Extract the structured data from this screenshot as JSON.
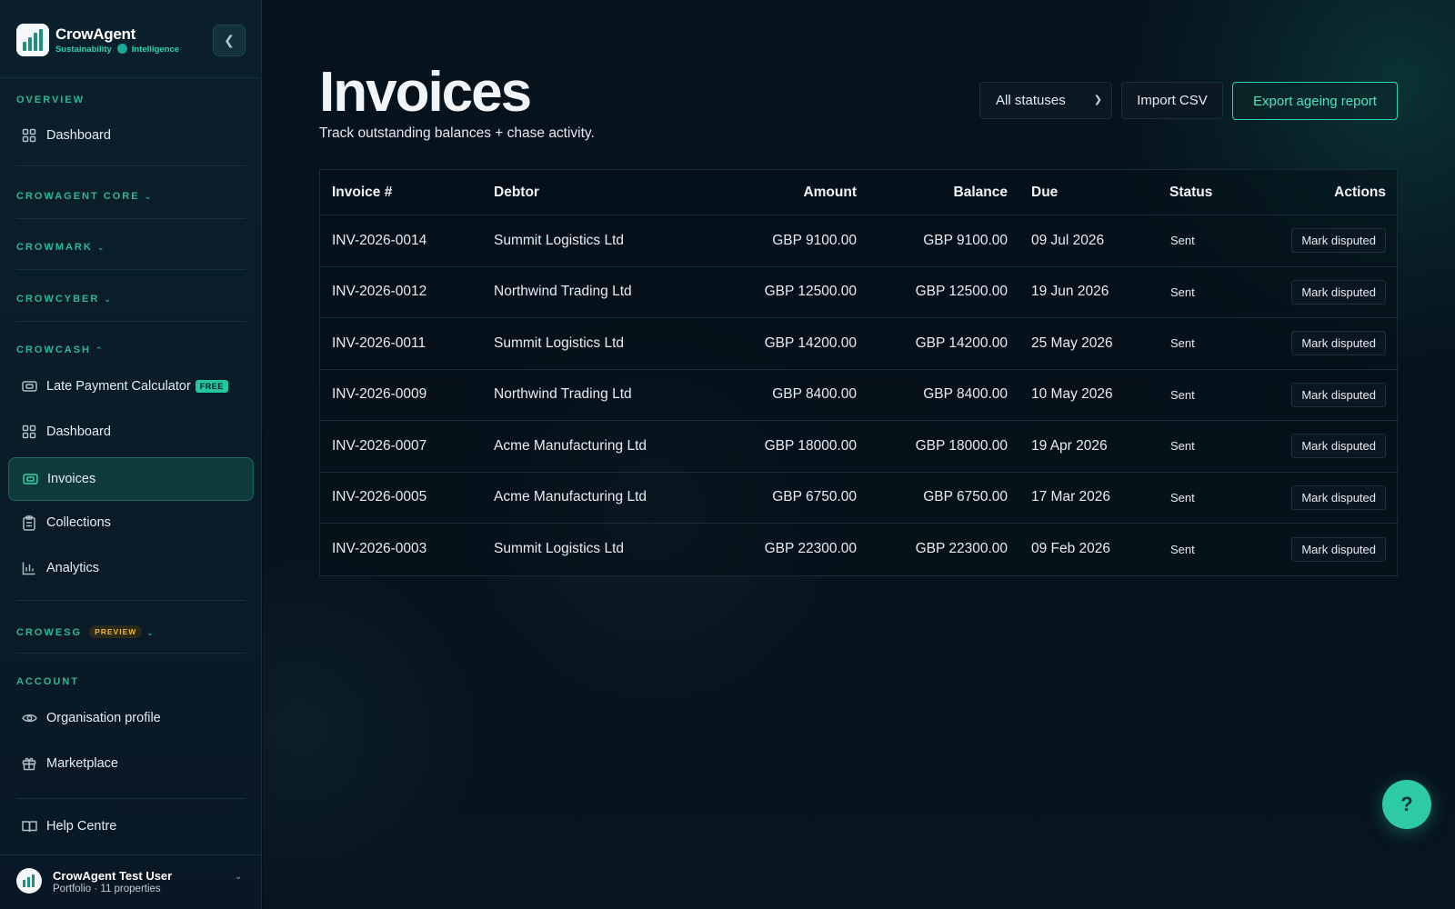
{
  "brand": {
    "name": "CrowAgent",
    "tag_left": "Sustainability",
    "tag_right": "Intelligence"
  },
  "sidebar": {
    "overview_label": "OVERVIEW",
    "overview_items": [
      {
        "label": "Dashboard",
        "icon": "grid-icon"
      }
    ],
    "core_label": "CROWAGENT CORE",
    "crowmark_label": "CROWMARK",
    "crowcyber_label": "CROWCYBER",
    "crowcash_label": "CROWCASH",
    "crowcash_items": [
      {
        "label": "Late Payment Calculator",
        "badge": "FREE",
        "icon": "calculator-icon"
      },
      {
        "label": "Dashboard",
        "icon": "grid-icon"
      },
      {
        "label": "Invoices",
        "icon": "invoice-icon",
        "active": true
      },
      {
        "label": "Collections",
        "icon": "clipboard-icon"
      },
      {
        "label": "Analytics",
        "icon": "bar-chart-icon"
      }
    ],
    "crowesg_label": "CROWESG",
    "crowesg_badge": "PREVIEW",
    "account_label": "ACCOUNT",
    "account_items": [
      {
        "label": "Organisation profile",
        "icon": "eye-icon"
      },
      {
        "label": "Marketplace",
        "icon": "gift-icon"
      }
    ],
    "help_label": "Help Centre",
    "user": {
      "name": "CrowAgent Test User",
      "subtitle": "Portfolio · 11 properties"
    }
  },
  "header": {
    "title": "Invoices",
    "subtitle": "Track outstanding balances + chase activity.",
    "status_filter": "All statuses",
    "import_label": "Import CSV",
    "export_label": "Export ageing report"
  },
  "table": {
    "columns": [
      "Invoice #",
      "Debtor",
      "Amount",
      "Balance",
      "Due",
      "Status",
      "Actions"
    ],
    "rows": [
      {
        "invoice": "INV-2026-0014",
        "debtor": "Summit Logistics Ltd",
        "amount": "GBP 9100.00",
        "balance": "GBP 9100.00",
        "due": "09 Jul 2026",
        "status": "Sent",
        "action": "Mark disputed"
      },
      {
        "invoice": "INV-2026-0012",
        "debtor": "Northwind Trading Ltd",
        "amount": "GBP 12500.00",
        "balance": "GBP 12500.00",
        "due": "19 Jun 2026",
        "status": "Sent",
        "action": "Mark disputed"
      },
      {
        "invoice": "INV-2026-0011",
        "debtor": "Summit Logistics Ltd",
        "amount": "GBP 14200.00",
        "balance": "GBP 14200.00",
        "due": "25 May 2026",
        "status": "Sent",
        "action": "Mark disputed"
      },
      {
        "invoice": "INV-2026-0009",
        "debtor": "Northwind Trading Ltd",
        "amount": "GBP 8400.00",
        "balance": "GBP 8400.00",
        "due": "10 May 2026",
        "status": "Sent",
        "action": "Mark disputed"
      },
      {
        "invoice": "INV-2026-0007",
        "debtor": "Acme Manufacturing Ltd",
        "amount": "GBP 18000.00",
        "balance": "GBP 18000.00",
        "due": "19 Apr 2026",
        "status": "Sent",
        "action": "Mark disputed"
      },
      {
        "invoice": "INV-2026-0005",
        "debtor": "Acme Manufacturing Ltd",
        "amount": "GBP 6750.00",
        "balance": "GBP 6750.00",
        "due": "17 Mar 2026",
        "status": "Sent",
        "action": "Mark disputed"
      },
      {
        "invoice": "INV-2026-0003",
        "debtor": "Summit Logistics Ltd",
        "amount": "GBP 22300.00",
        "balance": "GBP 22300.00",
        "due": "09 Feb 2026",
        "status": "Sent",
        "action": "Mark disputed"
      }
    ]
  },
  "help_fab": "?",
  "colors": {
    "accent": "#2dd4a8",
    "sidebar_bg": "#0b1f2c",
    "main_bg": "#06121c",
    "preview_badge": "#f0b53a"
  }
}
